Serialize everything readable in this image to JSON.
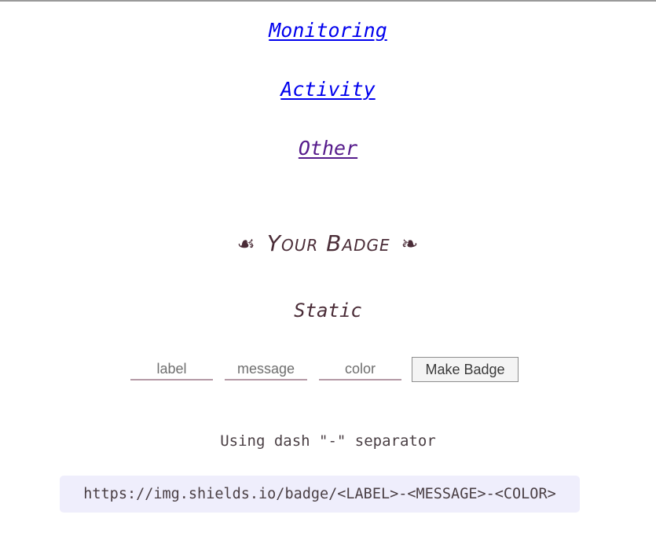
{
  "nav": {
    "monitoring": "Monitoring",
    "activity": "Activity",
    "other": "Other"
  },
  "badge_section": {
    "title": "Your Badge",
    "ornament_left": "☙",
    "ornament_right": "❧"
  },
  "static_section": {
    "title": "Static",
    "label_placeholder": "label",
    "message_placeholder": "message",
    "color_placeholder": "color",
    "make_badge_label": "Make Badge"
  },
  "separator_note": "Using dash \"-\" separator",
  "url_example": "https://img.shields.io/badge/<LABEL>-<MESSAGE>-<COLOR>",
  "colors": {
    "link": "#0000ee",
    "visited_link": "#551a8b",
    "heading": "#4a2c37",
    "code_bg": "#efeefc"
  }
}
